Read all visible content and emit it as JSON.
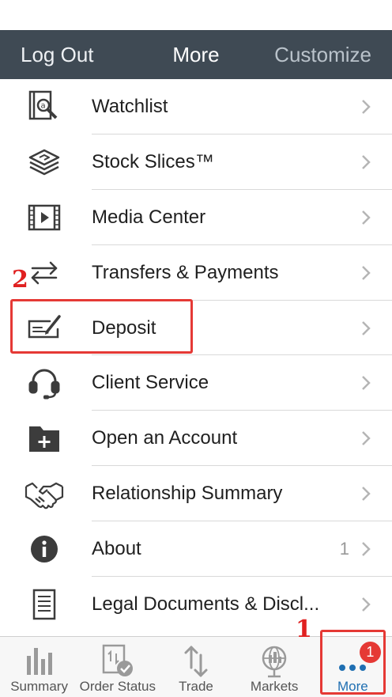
{
  "navbar": {
    "left_label": "Log Out",
    "title": "More",
    "right_label": "Customize"
  },
  "menu": {
    "items": [
      {
        "label": "Watchlist",
        "icon": "watchlist-icon"
      },
      {
        "label": "Stock Slices™",
        "icon": "stock-slices-icon"
      },
      {
        "label": "Media Center",
        "icon": "media-center-icon"
      },
      {
        "label": "Transfers & Payments",
        "icon": "transfer-arrows-icon"
      },
      {
        "label": "Deposit",
        "icon": "check-deposit-icon"
      },
      {
        "label": "Client Service",
        "icon": "headset-icon"
      },
      {
        "label": "Open an Account",
        "icon": "folder-add-icon"
      },
      {
        "label": "Relationship Summary",
        "icon": "handshake-icon"
      },
      {
        "label": "About",
        "icon": "info-icon",
        "count": "1"
      },
      {
        "label": "Legal Documents & Discl...",
        "icon": "document-icon"
      }
    ]
  },
  "annotations": {
    "step1": "1",
    "step2": "2"
  },
  "tabbar": {
    "tabs": [
      {
        "label": "Summary",
        "icon": "bar-chart-icon"
      },
      {
        "label": "Order Status",
        "icon": "order-status-icon"
      },
      {
        "label": "Trade",
        "icon": "trade-arrows-icon"
      },
      {
        "label": "Markets",
        "icon": "globe-chart-icon"
      },
      {
        "label": "More",
        "icon": "more-dots-icon",
        "active": true,
        "badge": "1"
      }
    ]
  },
  "colors": {
    "navbar_bg": "#3f4a54",
    "accent": "#1f6fb2",
    "annotation": "#e53935",
    "icon": "#3c3c3c"
  }
}
